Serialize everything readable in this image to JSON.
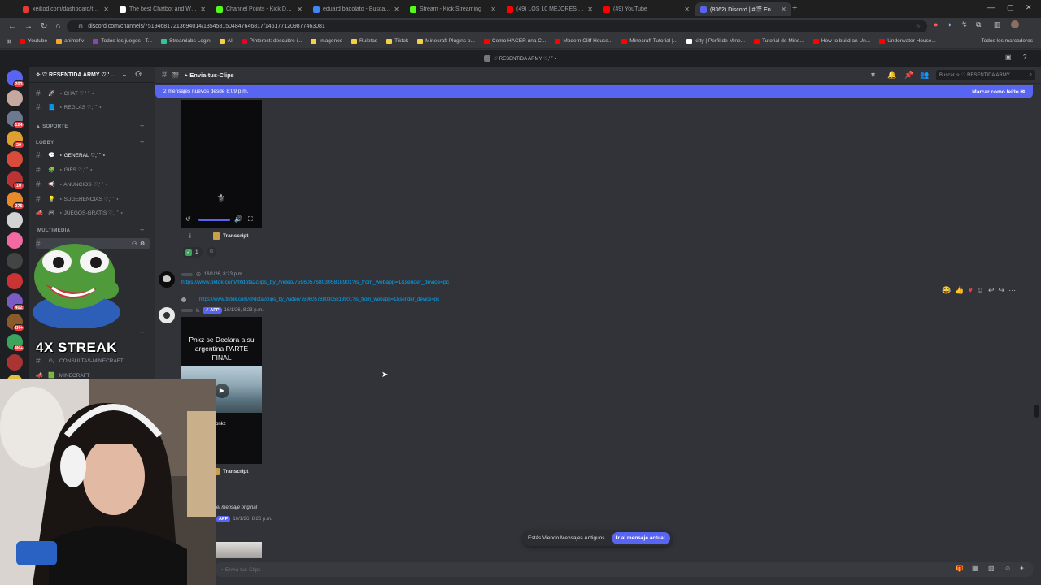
{
  "browser": {
    "tabs": [
      {
        "title": "xeikod.com/dashboard/tasks",
        "color": "#e53935",
        "active": false
      },
      {
        "title": "The best Chatbot and Widgets",
        "color": "#ffffff",
        "active": false
      },
      {
        "title": "Channel Points - Kick Dashboard",
        "color": "#53fc18",
        "active": false
      },
      {
        "title": "eduard badolato - Buscar con Google",
        "color": "#4285f4",
        "active": false
      },
      {
        "title": "Stream - Kick Streaming",
        "color": "#53fc18",
        "active": false
      },
      {
        "title": "(49) LOS 10 MEJORES GANCHOS",
        "color": "#ff0000",
        "active": false
      },
      {
        "title": "(49) YouTube",
        "color": "#ff0000",
        "active": false
      },
      {
        "title": "(8362) Discord | #🎬 Envia-tus-Clips",
        "color": "#5865f2",
        "active": true
      }
    ],
    "url": "discord.com/channels/751946817213694014/1354581504847646817/1461771209877463081",
    "bookmarks": [
      {
        "label": "Youtube",
        "color": "#ff0000"
      },
      {
        "label": "animeflv",
        "color": "#f5a623"
      },
      {
        "label": "Todos los juegos - T...",
        "color": "#8e44ad"
      },
      {
        "label": "Streamlabs Login",
        "color": "#31c3a2"
      },
      {
        "label": "AI",
        "color": "#f5d142"
      },
      {
        "label": "Pinterest: descubre i...",
        "color": "#e60023"
      },
      {
        "label": "Imagenes",
        "color": "#f5d142"
      },
      {
        "label": "Ruletas",
        "color": "#f5d142"
      },
      {
        "label": "Tiktok",
        "color": "#f5d142"
      },
      {
        "label": "Minecraft Plugins p...",
        "color": "#f5d142"
      },
      {
        "label": "Como HACER una C...",
        "color": "#ff0000"
      },
      {
        "label": "Modern Cliff House...",
        "color": "#ff0000"
      },
      {
        "label": "Minecraft Tutorial |...",
        "color": "#ff0000"
      },
      {
        "label": "kitty | Perfil de Mine...",
        "color": "#ffffff"
      },
      {
        "label": "Tutorial de Mine...",
        "color": "#ff0000"
      },
      {
        "label": "How to build an Un...",
        "color": "#ff0000"
      },
      {
        "label": "Underwater House...",
        "color": "#ff0000"
      }
    ],
    "bookmarks_right": "Todos los marcadores"
  },
  "discord": {
    "top_title": "♡ RESENTIDA ARMY ♡,' ˚ ⋆",
    "server_name": "✧ ♡ RESENTIDA ARMY ♡,' ...",
    "categories": {
      "soporte": "▲ SOPORTE",
      "lobby": "LOBBY",
      "multimedia": "MULTIMEDIA"
    },
    "channels": [
      {
        "label": "⋆ CHAT ♡,' ˚ ⋆",
        "emoji": "🚀",
        "icon": "hash",
        "state": "normal"
      },
      {
        "label": "⋆ REGLAS ♡,' ˚ ⋆",
        "emoji": "📘",
        "icon": "hash",
        "state": "normal"
      },
      {
        "label": "⋆ GENERAL ♡,' ˚ ⋆",
        "emoji": "💬",
        "icon": "hash",
        "state": "unread"
      },
      {
        "label": "⋆ GIFS ♡,' ˚ ⋆",
        "emoji": "🧩",
        "icon": "hash",
        "state": "normal"
      },
      {
        "label": "⋆ ANUNCIOS ♡,' ˚ ⋆",
        "emoji": "📢",
        "icon": "hash",
        "state": "normal"
      },
      {
        "label": "⋆ SUGERENCIAS ♡,' ˚ ⋆",
        "emoji": "💡",
        "icon": "hash",
        "state": "normal"
      },
      {
        "label": "⋆ JUEGOS-GRATIS ♡,' ˚ ⋆",
        "emoji": "🎮",
        "icon": "announce",
        "state": "normal"
      }
    ],
    "multimedia_channels": [
      {
        "label": "CONSULTAS-MINECRAFT",
        "emoji": "⛏",
        "icon": "hash"
      },
      {
        "label": "MINECRAFT",
        "emoji": "🟩",
        "icon": "announce"
      }
    ],
    "channel_header": "⋆ Envia-tus-Clips",
    "search_placeholder": "Buscar ✧ ♡ RESENTIDA ARMY",
    "new_messages_bar": "2 mensajes nuevos desde 8:09 p.m.",
    "mark_read": "Marcar como leído",
    "server_badges": [
      "203",
      "",
      "124",
      "20",
      "",
      "10",
      "275",
      "",
      "",
      "",
      "",
      "402",
      "2K+",
      "4K+",
      "",
      "517"
    ],
    "messages": [
      {
        "transcript": "Transcript",
        "reaction_count": "1"
      },
      {
        "time": "16/1/26, 8:23 p.m.",
        "link": "https://www.tiktok.com/@dota2clips_by_/video/7596057680305818901?is_from_webapp=1&sender_device=pc"
      },
      {
        "reply_link": "https://www.tiktok.com/@dota2clips_by_/video/7596057680305818901?is_from_webapp=1&sender_device=pc",
        "app_tag": "APP",
        "time": "16/1/26, 8:23 p.m.",
        "video_caption": "Pnkz se Declara a su argentina PARTE FINAL",
        "video_name": "onkz",
        "transcript": "Transcript"
      },
      {
        "note": "el mensaje original",
        "app_tag": "APP",
        "time": "16/1/26, 8:26 p.m."
      }
    ],
    "old_messages_notice": "Estás Viendo Mensajes Antiguos",
    "jump_button": "Ir al mensaje actual",
    "composer_placeholder": "⋆ Envia-tus-Clips"
  },
  "overlay": {
    "streak": "4X STREAK"
  }
}
